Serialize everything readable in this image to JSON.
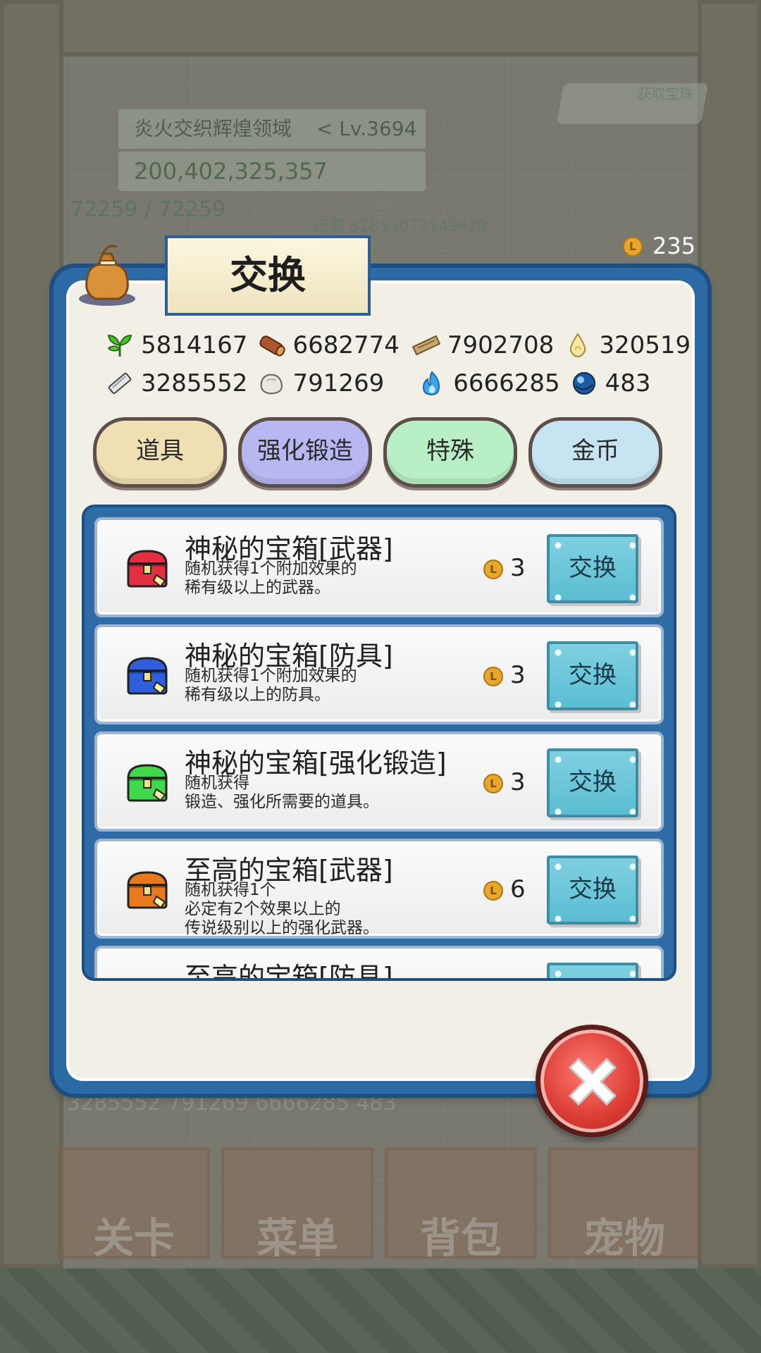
{
  "hud": {
    "player_name": "炎火交织辉煌领域",
    "level": "< Lv.3694 >",
    "gold": "200,402,325,357",
    "hp": "72259 / 72259",
    "exp_percent": "64.75%",
    "exp_remaining": "还要 82853073149629",
    "get_button": "获取宝珠",
    "coin_balance": "235"
  },
  "dialog": {
    "title": "交换",
    "resources_row1": [
      {
        "icon": "herb-icon",
        "value": "5814167"
      },
      {
        "icon": "log-icon",
        "value": "6682774"
      },
      {
        "icon": "plank-icon",
        "value": "7902708"
      },
      {
        "icon": "drop-icon",
        "value": "320519"
      }
    ],
    "resources_row2": [
      {
        "icon": "ingot-icon",
        "value": "3285552"
      },
      {
        "icon": "stone-icon",
        "value": "791269"
      },
      {
        "icon": "flame-icon",
        "value": "6666285"
      },
      {
        "icon": "orb-icon",
        "value": "483"
      }
    ],
    "tabs": [
      {
        "label": "道具",
        "color": "#f0dfb2"
      },
      {
        "label": "强化锻造",
        "color": "#b7b7f2"
      },
      {
        "label": "特殊",
        "color": "#b8efc4"
      },
      {
        "label": "金币",
        "color": "#c7e4f2"
      }
    ],
    "items": [
      {
        "name": "神秘的宝箱[武器]",
        "desc": "随机获得1个附加效果的\n稀有级以上的武器。",
        "price": "3",
        "button": "交换",
        "chest_color": "#e33040"
      },
      {
        "name": "神秘的宝箱[防具]",
        "desc": "随机获得1个附加效果的\n稀有级以上的防具。",
        "price": "3",
        "button": "交换",
        "chest_color": "#2f5fdc"
      },
      {
        "name": "神秘的宝箱[强化锻造]",
        "desc": "随机获得\n锻造、强化所需要的道具。",
        "price": "3",
        "button": "交换",
        "chest_color": "#3fd84a"
      },
      {
        "name": "至高的宝箱[武器]",
        "desc": "随机获得1个\n必定有2个效果以上的\n传说级别以上的强化武器。",
        "price": "6",
        "button": "交换",
        "chest_color": "#e8791c"
      },
      {
        "name": "至高的宝箱[防具]",
        "desc": "",
        "price": "",
        "button": "",
        "chest_color": "#e8791c"
      }
    ]
  },
  "bottom_resources": "3285552   791269   6666285   483",
  "nav": [
    "关卡",
    "菜单",
    "背包",
    "宠物"
  ]
}
